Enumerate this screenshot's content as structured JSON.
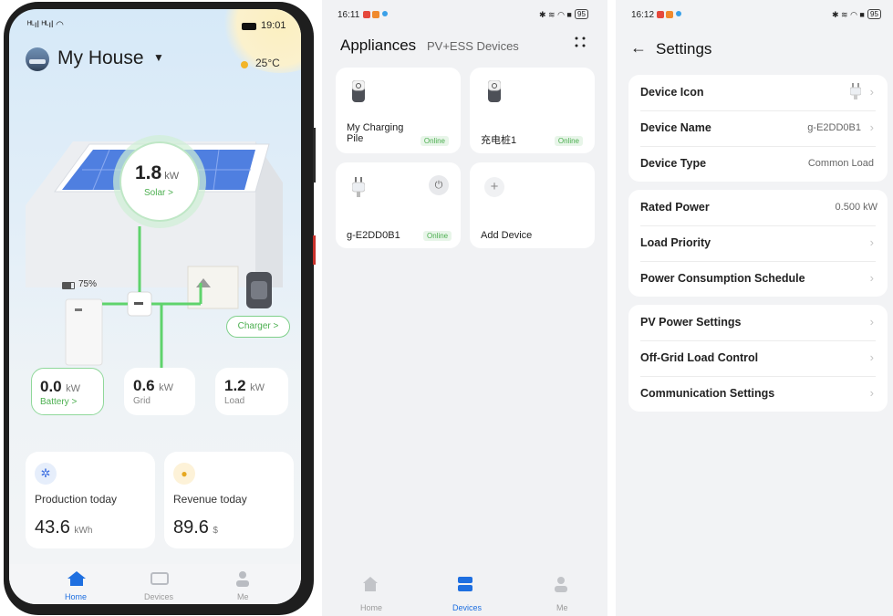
{
  "home": {
    "status_time": "19:01",
    "status_signal": "ᴴᴸıl ᴴᴸıl",
    "house_name": "My House",
    "temperature": "25°C",
    "solar": {
      "value": "1.8",
      "unit": "kW",
      "label": "Solar >"
    },
    "battery_percent": "75%",
    "charger_label": "Charger >",
    "metrics": [
      {
        "value": "0.0",
        "unit": "kW",
        "label": "Battery >"
      },
      {
        "value": "0.6",
        "unit": "kW",
        "label": "Grid"
      },
      {
        "value": "1.2",
        "unit": "kW",
        "label": "Load"
      }
    ],
    "production": {
      "label": "Production today",
      "value": "43.6",
      "unit": "kWh"
    },
    "revenue": {
      "label": "Revenue today",
      "value": "89.6",
      "unit": "$"
    },
    "nav": [
      "Home",
      "Devices",
      "Me"
    ],
    "colors": {
      "accent": "#1e6fe0",
      "green": "#4caf50",
      "solar": "#3d6fe0"
    }
  },
  "devices": {
    "status_time": "16:11",
    "battery": "95",
    "title": "Appliances",
    "subtitle": "PV+ESS Devices",
    "items": [
      {
        "name": "My Charging Pile",
        "status": "Online"
      },
      {
        "name": "充电桩1",
        "status": "Online"
      },
      {
        "name": "g-E2DD0B1",
        "status": "Online"
      },
      {
        "name": "Add Device",
        "status": ""
      }
    ],
    "nav": [
      "Home",
      "Devices",
      "Me"
    ]
  },
  "settings": {
    "status_time": "16:12",
    "battery": "95",
    "title": "Settings",
    "rows": [
      {
        "label": "Device Icon",
        "value": ""
      },
      {
        "label": "Device Name",
        "value": "g-E2DD0B1"
      },
      {
        "label": "Device Type",
        "value": "Common Load"
      },
      {
        "label": "Rated Power",
        "value": "0.500 kW"
      },
      {
        "label": "Load Priority",
        "value": ""
      },
      {
        "label": "Power Consumption Schedule",
        "value": ""
      },
      {
        "label": "PV Power Settings",
        "value": ""
      },
      {
        "label": "Off-Grid Load Control",
        "value": ""
      },
      {
        "label": "Communication Settings",
        "value": ""
      }
    ]
  }
}
